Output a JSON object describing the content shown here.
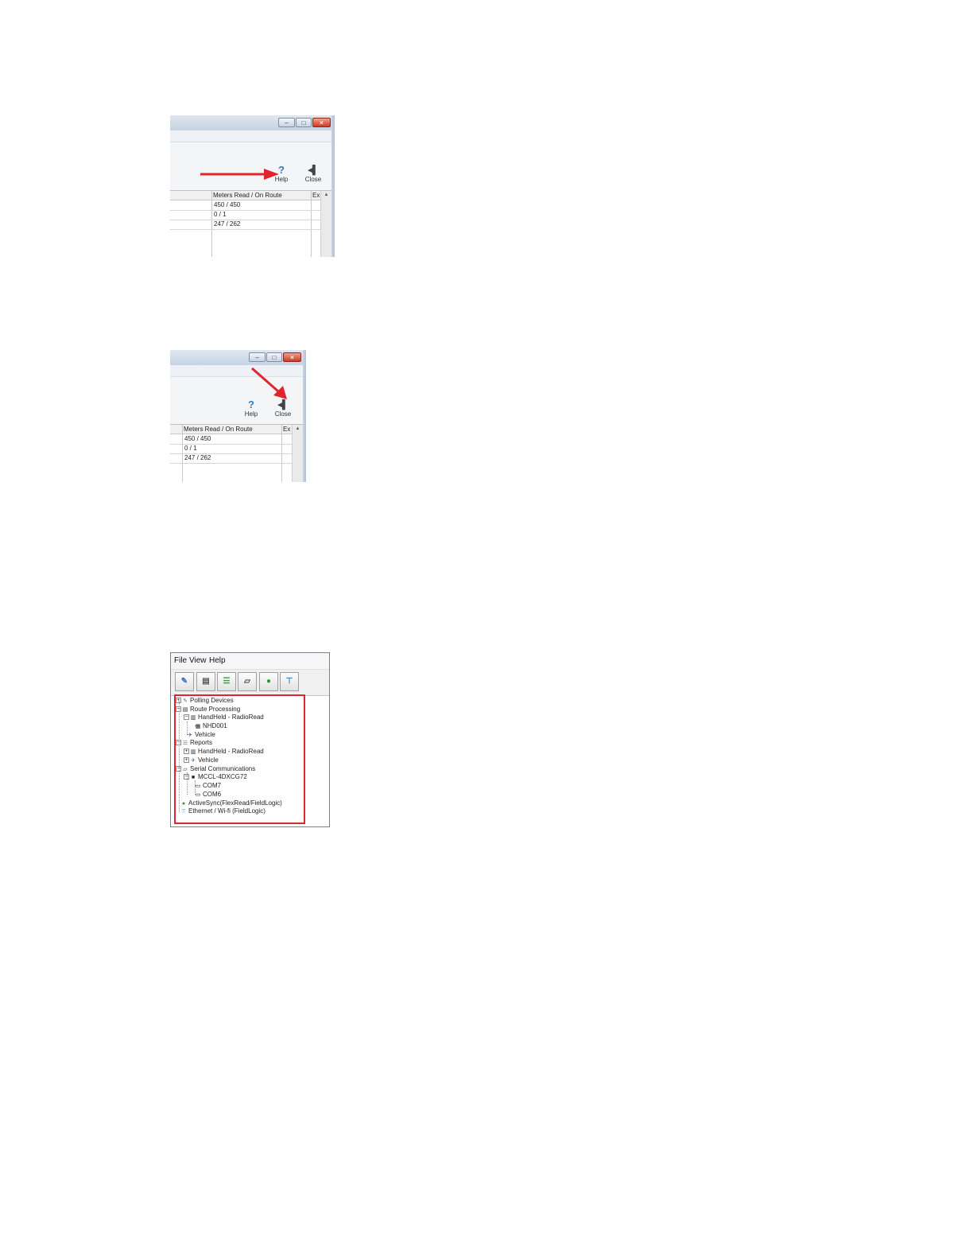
{
  "shot1": {
    "caption_buttons": {
      "minimize": "–",
      "maximize": "□",
      "close": "×"
    },
    "toolbar": {
      "help_label": "Help",
      "close_label": "Close"
    },
    "grid": {
      "column_header": "Meters Read / On Route",
      "column_header_extra": "Ex",
      "rows": [
        "450 / 450",
        "0 / 1",
        "247 / 262"
      ]
    }
  },
  "shot2": {
    "caption_buttons": {
      "minimize": "–",
      "maximize": "□",
      "close": "×"
    },
    "toolbar": {
      "help_label": "Help",
      "close_label": "Close"
    },
    "grid": {
      "column_header": "Meters Read / On Route",
      "column_header_extra": "Ex",
      "rows": [
        "450 / 450",
        "0 / 1",
        "247 / 262"
      ]
    }
  },
  "app": {
    "menu": {
      "file": "File",
      "view": "View",
      "help": "Help"
    },
    "tree": {
      "polling_devices": "Polling Devices",
      "route_processing": "Route Processing",
      "rp_handheld": "HandHeld - RadioRead",
      "rp_handheld_child": "NHD001",
      "rp_vehicle": "Vehicle",
      "reports": "Reports",
      "rep_handheld": "HandHeld - RadioRead",
      "rep_vehicle": "Vehicle",
      "serial_communications": "Serial Communications",
      "serial_host": "MCCL-4DXCG72",
      "com7": "COM7",
      "com6": "COM6",
      "activesync": "ActiveSync(FlexRead/FieldLogic)",
      "ethernet": "Ethernet / Wi-fi (FieldLogic)"
    }
  },
  "colors": {
    "highlight": "#e0262c",
    "arrow": "#e0262c",
    "help_icon": "#2c7fc4"
  }
}
